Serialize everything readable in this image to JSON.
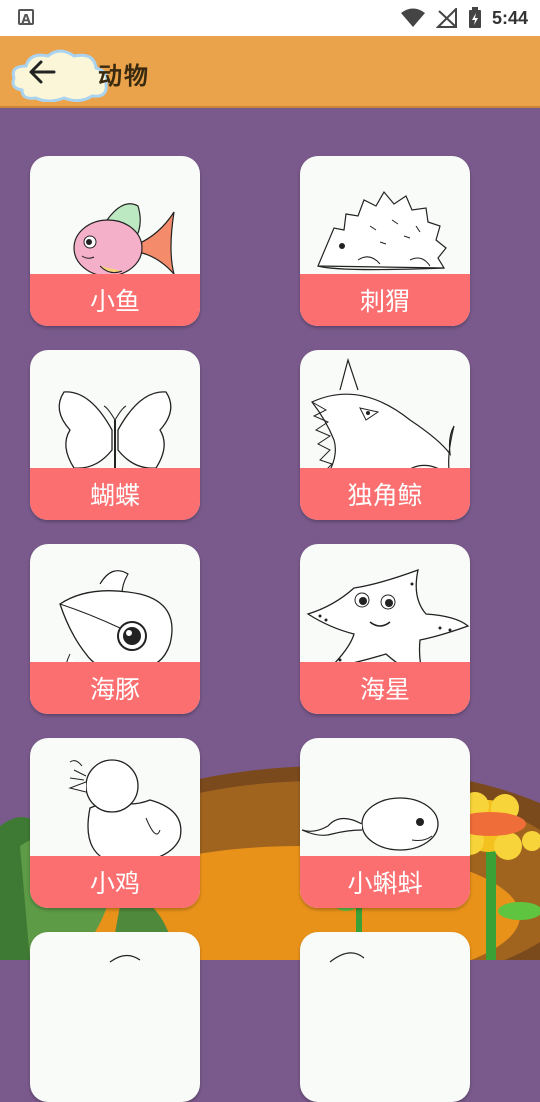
{
  "status": {
    "time": "5:44"
  },
  "header": {
    "title": "动物"
  },
  "animals": [
    {
      "label": "小鱼"
    },
    {
      "label": "刺猬"
    },
    {
      "label": "蝴蝶"
    },
    {
      "label": "独角鲸"
    },
    {
      "label": "海豚"
    },
    {
      "label": "海星"
    },
    {
      "label": "小鸡"
    },
    {
      "label": "小蝌蚪"
    }
  ],
  "colors": {
    "appbar": "#eba34b",
    "background": "#7a5a8c",
    "card": "#f8fbf7",
    "label_band": "#fb6f70"
  }
}
